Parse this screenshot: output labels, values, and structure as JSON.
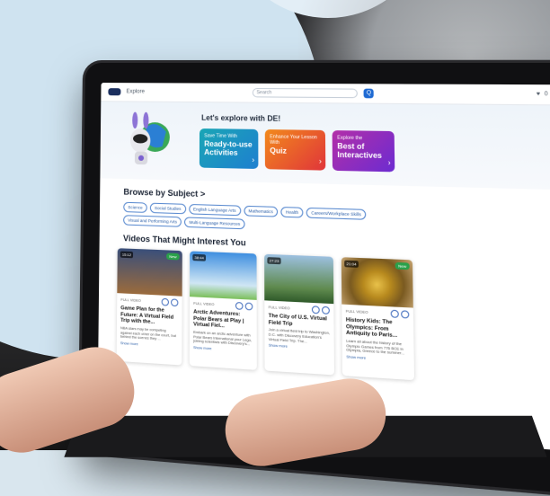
{
  "topbar": {
    "brand": "Explore",
    "search_placeholder": "Search",
    "search_button": "Q",
    "right_count": "0"
  },
  "hero": {
    "title": "Let's explore with DE!",
    "cards": [
      {
        "small": "Save Time With",
        "big": "Ready-to-use Activities"
      },
      {
        "small": "Enhance Your Lesson With",
        "big": "Quiz"
      },
      {
        "small": "Explore the",
        "big": "Best of Interactives"
      }
    ]
  },
  "browse": {
    "title": "Browse by Subject >",
    "chips": [
      "Science",
      "Social Studies",
      "English Language Arts",
      "Mathematics",
      "Health",
      "Careers/Workplace Skills",
      "Visual and Performing Arts",
      "Multi-Language Resources"
    ]
  },
  "videos": {
    "title": "Videos That Might Interest You",
    "items": [
      {
        "duration": "15:12",
        "badge": "New",
        "tag": "FULL VIDEO",
        "title": "Game Plan for the Future: A Virtual Field Trip with the...",
        "desc": "NBA stars may be competing against each other on the court, but behind the scenes they ...",
        "more": "Show more"
      },
      {
        "duration": "38:44",
        "badge": "",
        "tag": "FULL VIDEO",
        "title": "Arctic Adventures: Polar Bears at Play | Virtual Fiel...",
        "desc": "Embark on an arctic adventure with Polar Bears International your Lego, joining scientists with Discovery's...",
        "more": "Show more"
      },
      {
        "duration": "27:23",
        "badge": "",
        "tag": "FULL VIDEO",
        "title": "The City of U.S. Virtual Field Trip",
        "desc": "Join a virtual field trip to Washington, D.C. with Discovery Education's Virtual Field Trip. The...",
        "more": "Show more"
      },
      {
        "duration": "21:04",
        "badge": "New",
        "tag": "FULL VIDEO",
        "title": "History Kids: The Olympics: From Antiquity to Paris...",
        "desc": "Learn all about the history of the Olympic Games from 776 BCE in Olympia, Greece to the summer...",
        "more": "Show more"
      }
    ]
  },
  "colors": {
    "accent": "#1e6ad3",
    "new_badge": "#2aa14a"
  }
}
